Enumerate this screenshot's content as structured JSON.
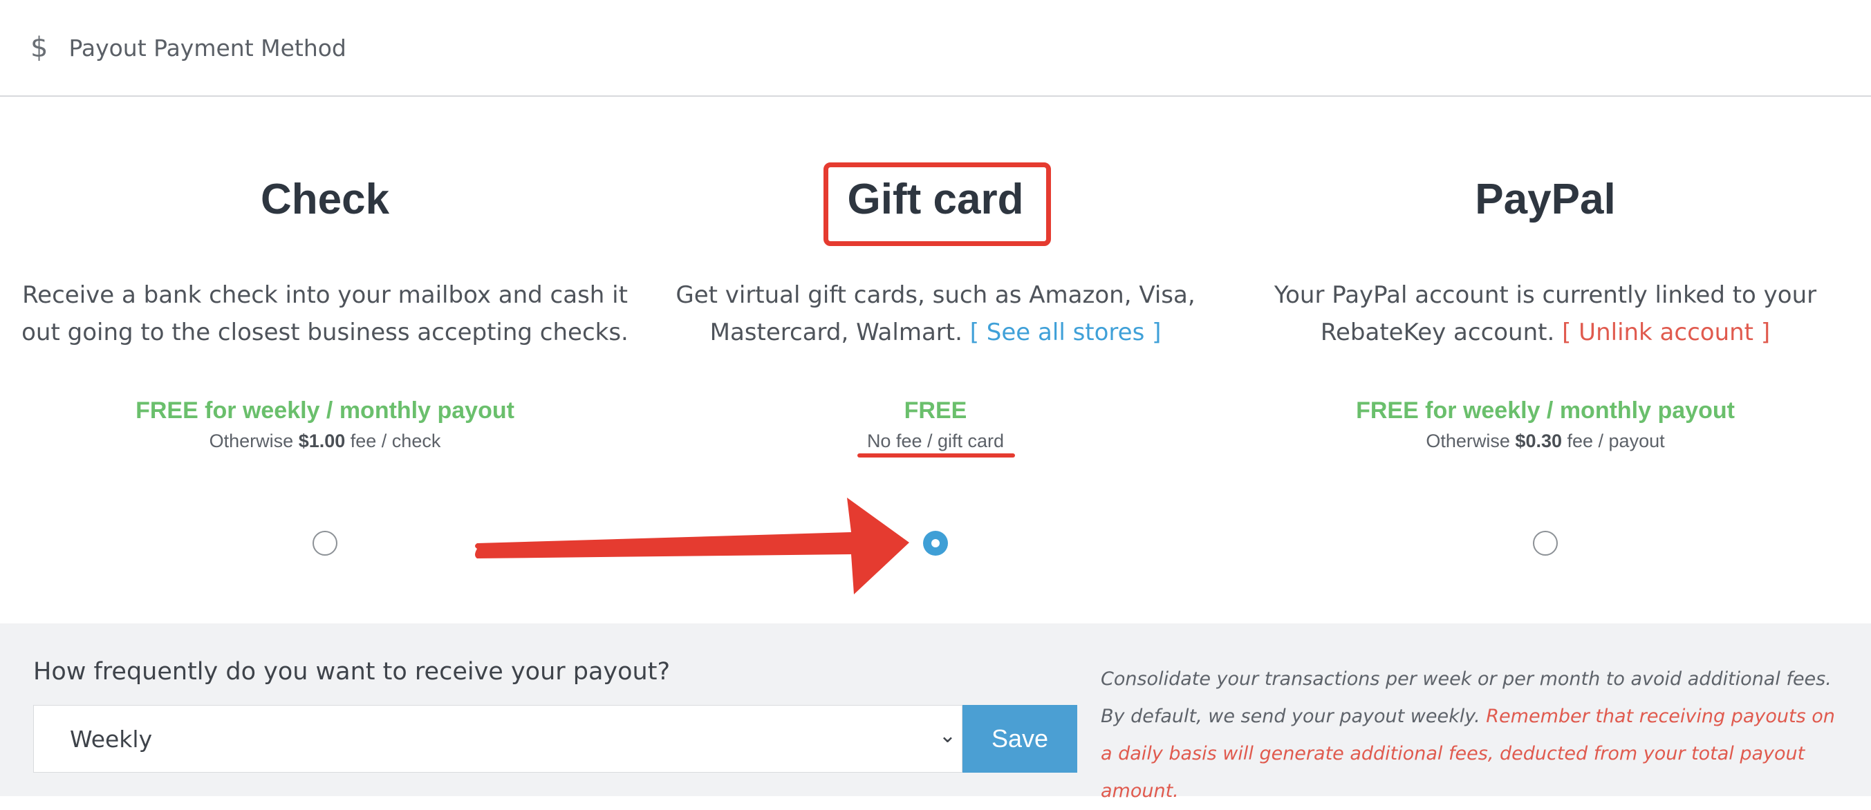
{
  "header": {
    "icon": "dollar-icon",
    "icon_glyph": "$",
    "title": "Payout Payment Method"
  },
  "methods": [
    {
      "name": "Check",
      "description": "Receive a bank check into your mailbox and cash it out going to the closest business accepting checks.",
      "price": "FREE for weekly / monthly payout",
      "sub_prefix": "Otherwise ",
      "sub_amount": "$1.00",
      "sub_suffix": " fee / check",
      "selected": false
    },
    {
      "name": "Gift card",
      "description": "Get virtual gift cards, such as Amazon, Visa, Mastercard, Walmart.",
      "link": "[ See all stores ]",
      "price": "FREE",
      "sub": "No fee / gift card",
      "selected": true
    },
    {
      "name": "PayPal",
      "description": "Your PayPal account is currently linked to your RebateKey account.",
      "link": "[ Unlink account ]",
      "price": "FREE for weekly / monthly payout",
      "sub_prefix": "Otherwise ",
      "sub_amount": "$0.30",
      "sub_suffix": " fee / payout",
      "selected": false
    }
  ],
  "payout": {
    "question": "How frequently do you want to receive your payout?",
    "frequency_value": "Weekly",
    "save_label": "Save",
    "help_text": "Consolidate your transactions per week or per month to avoid additional fees. By default, we send your payout weekly.",
    "help_warning": "Remember that receiving payouts on a daily basis will generate additional fees, deducted from your total payout amount."
  },
  "colors": {
    "accent_blue": "#4b9fd3",
    "free_green": "#6abf6c",
    "warning_red": "#e05a4e",
    "annotation_red": "#e53b30"
  }
}
